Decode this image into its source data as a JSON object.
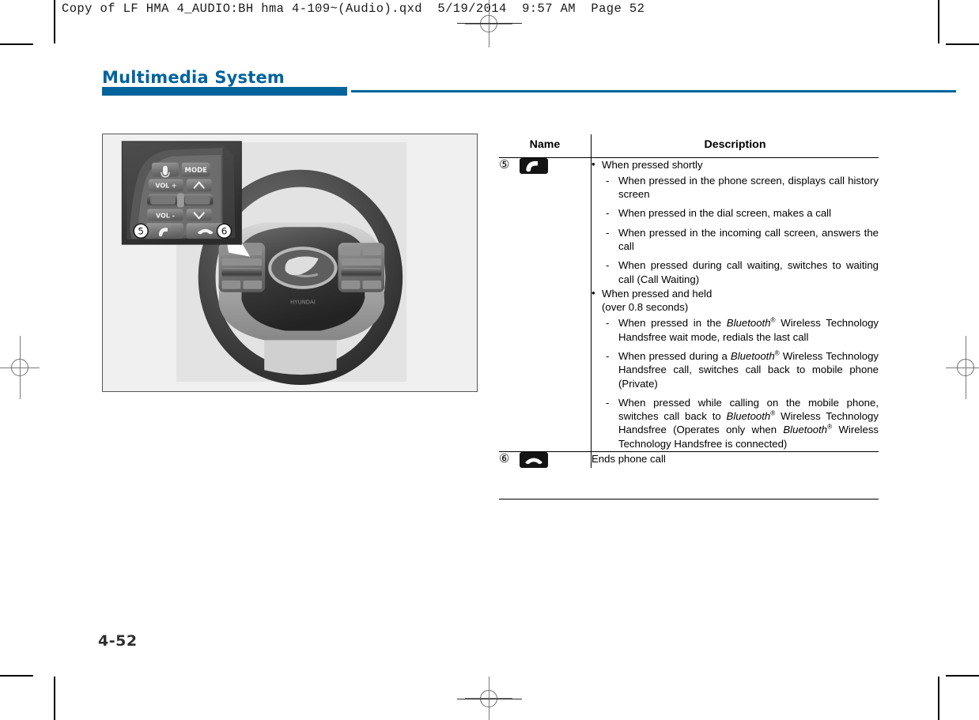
{
  "printers_marks": {
    "slug_line": "Copy of LF HMA 4_AUDIO:BH hma 4-109~(Audio).qxd  5/19/2014  9:57 AM  Page 52"
  },
  "page": {
    "section_title": "Multimedia System",
    "folio": "4-52"
  },
  "figure": {
    "caption_numbers": [
      "⑤",
      "⑥"
    ],
    "callout_buttons": {
      "voice_recognition": "voice-recognition-icon",
      "mode": "MODE",
      "volume_up": "VOL +",
      "volume_down": "VOL -",
      "seek_up": "∧",
      "seek_down": "∨",
      "call": "call-icon",
      "end_call": "end-call-icon"
    },
    "brand": "HYUNDAI"
  },
  "table": {
    "headers": {
      "name": "Name",
      "description": "Description"
    },
    "rows": [
      {
        "number": "⑤",
        "icon": "call-icon",
        "blocks": [
          {
            "bullet": "When pressed shortly",
            "items": [
              "When pressed in the phone screen, displays call history screen",
              "When pressed in the dial screen, makes a call",
              "When pressed in the incoming call screen, answers the call",
              "When pressed during call waiting, switches to waiting call (Call Waiting)"
            ]
          },
          {
            "bullet": "When pressed and held",
            "bullet_line2": "(over 0.8 seconds)",
            "items_rich": [
              {
                "prefix": "When pressed in the ",
                "trademark": "Bluetooth",
                "suffix": " Wireless Technology Handsfree wait mode, redials the last call"
              },
              {
                "prefix": "When pressed during a ",
                "trademark": "Bluetooth",
                "suffix": " Wireless Technology Handsfree call, switches call back to mobile phone (Private)"
              },
              {
                "prefix": "When pressed while calling on the mobile phone, switches call back to ",
                "trademark": "Bluetooth",
                "suffix": " Wireless Technology Handsfree (Operates only when ",
                "trademark2": "Bluetooth",
                "suffix2": " Wireless Technology Handsfree is connected)"
              }
            ]
          }
        ]
      },
      {
        "number": "⑥",
        "icon": "end-call-icon",
        "description": "Ends phone call"
      }
    ]
  },
  "colors": {
    "accent_blue": "#00639c",
    "icon_black": "#141414",
    "folio_gray": "#2f2f2f"
  }
}
